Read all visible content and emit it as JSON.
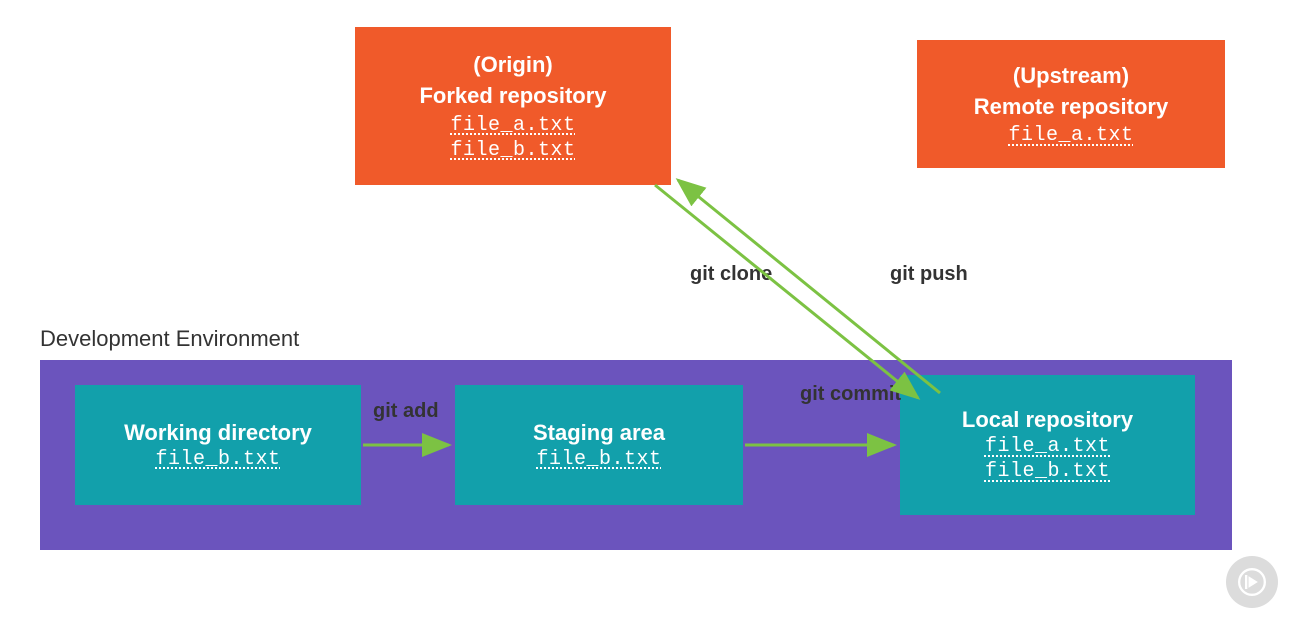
{
  "origin": {
    "tag": "(Origin)",
    "title": "Forked repository",
    "files": [
      "file_a.txt",
      "file_b.txt"
    ]
  },
  "upstream": {
    "tag": "(Upstream)",
    "title": "Remote repository",
    "files": [
      "file_a.txt"
    ]
  },
  "dev_env": {
    "label": "Development Environment",
    "working": {
      "title": "Working directory",
      "files": [
        "file_b.txt"
      ]
    },
    "staging": {
      "title": "Staging area",
      "files": [
        "file_b.txt"
      ]
    },
    "local": {
      "title": "Local repository",
      "files": [
        "file_a.txt",
        "file_b.txt"
      ]
    }
  },
  "arrows": {
    "add": "git add",
    "commit": "git commit",
    "clone": "git clone",
    "push": "git push"
  },
  "watermark": "pluralsight-logo"
}
